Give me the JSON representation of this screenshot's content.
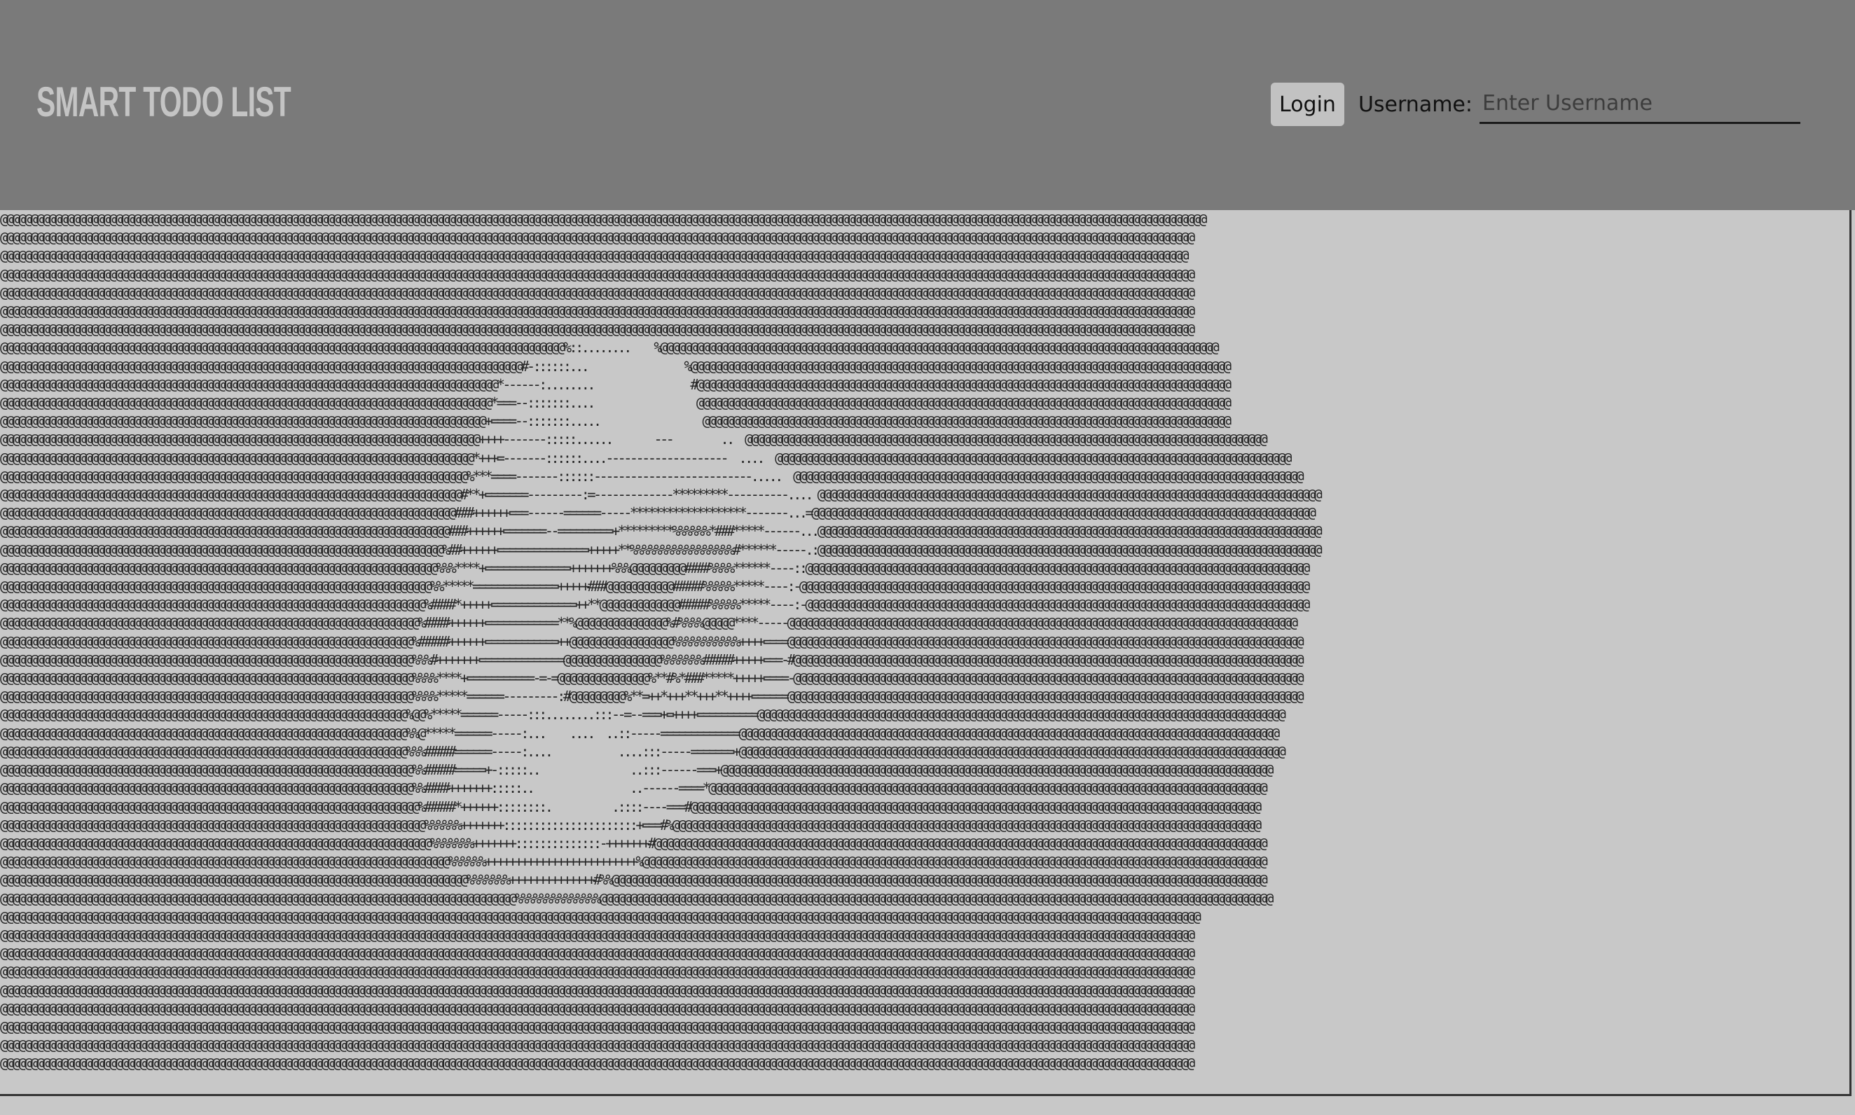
{
  "header": {
    "title": "SMART TODO LIST",
    "login_label": "Login",
    "username_label": "Username:",
    "username_placeholder": "Enter Username",
    "username_value": ""
  },
  "hero": {
    "ascii_rows": [
      "@@@@@@@@@@@@@@@@@@@@@@@@@@@@@@@@@@@@@@@@@@@@@@@@@@@@@@@@@@@@@@@@@@@@@@@@@@@@@@@@@@@@@@@@@@@@@@@@@@@@@@@@@@@@@@@@@@@@@@@@@@@@@@@@@@@@@@@@@@@@@@@@@@@@@@@@@@@@@@@@@@@@@@@@@@@@@@@@@@@@@@@@@@@@@@@@@@@@@@@",
      "@@@@@@@@@@@@@@@@@@@@@@@@@@@@@@@@@@@@@@@@@@@@@@@@@@@@@@@@@@@@@@@@@@@@@@@@@@@@@@@@@@@@@@@@@@@@@@@@@@@@@@@@@@@@@@@@@@@@@@@@@@@@@@@@@@@@@@@@@@@@@@@@@@@@@@@@@@@@@@@@@@@@@@@@@@@@@@@@@@@@@@@@@@@@@@@@@@@@@",
      "@@@@@@@@@@@@@@@@@@@@@@@@@@@@@@@@@@@@@@@@@@@@@@@@@@@@@@@@@@@@@@@@@@@@@@@@@@@@@@@@@@@@@@@@@@@@@@@@@@@@@@@@@@@@@@@@@@@@@@@@@@@@@@@@@@@@@@@@@@@@@@@@@@@@@@@@@@@@@@@@@@@@@@@@@@@@@@@@@@@@@@@@@@@@@@@@@@@@",
      "@@@@@@@@@@@@@@@@@@@@@@@@@@@@@@@@@@@@@@@@@@@@@@@@@@@@@@@@@@@@@@@@@@@@@@@@@@@@@@@@@@@@@@@@@@@@@@@@@@@@@@@@@@@@@@@@@@@@@@@@@@@@@@@@@@@@@@@@@@@@@@@@@@@@@@@@@@@@@@@@@@@@@@@@@@@@@@@@@@@@@@@@@@@@@@@@@@@@@",
      "@@@@@@@@@@@@@@@@@@@@@@@@@@@@@@@@@@@@@@@@@@@@@@@@@@@@@@@@@@@@@@@@@@@@@@@@@@@@@@@@@@@@@@@@@@@@@@@@@@@@@@@@@@@@@@@@@@@@@@@@@@@@@@@@@@@@@@@@@@@@@@@@@@@@@@@@@@@@@@@@@@@@@@@@@@@@@@@@@@@@@@@@@@@@@@@@@@@@@",
      "@@@@@@@@@@@@@@@@@@@@@@@@@@@@@@@@@@@@@@@@@@@@@@@@@@@@@@@@@@@@@@@@@@@@@@@@@@@@@@@@@@@@@@@@@@@@@@@@@@@@@@@@@@@@@@@@@@@@@@@@@@@@@@@@@@@@@@@@@@@@@@@@@@@@@@@@@@@@@@@@@@@@@@@@@@@@@@@@@@@@@@@@@@@@@@@@@@@@@",
      "@@@@@@@@@@@@@@@@@@@@@@@@@@@@@@@@@@@@@@@@@@@@@@@@@@@@@@@@@@@@@@@@@@@@@@@@@@@@@@@@@@@@@@@@@@@@@@@@@@@@@@@@@@@@@@@@@@@@@@@@@@@@@@@@@@@@@@@@@@@@@@@@@@@@@@@@@@@@@@@@@@@@@@@@@@@@@@@@@@@@@@@@@@@@@@@@@@@@@",
      "@@@@@@@@@@@@@@@@@@@@@@@@@@@@@@@@@@@@@@@@@@@@@@@@@@@@@@@@@@@@@@@@@@@@@@@@@@@@@@@@@@@@@@@@@@@@@%::........    %@@@@@@@@@@@@@@@@@@@@@@@@@@@@@@@@@@@@@@@@@@@@@@@@@@@@@@@@@@@@@@@@@@@@@@@@@@@@@@@@@@@@@@@@@@@@",
      "@@@@@@@@@@@@@@@@@@@@@@@@@@@@@@@@@@@@@@@@@@@@@@@@@@@@@@@@@@@@@@@@@@@@@@@@@@@@@@@@@@@@@@#-::::::...                %@@@@@@@@@@@@@@@@@@@@@@@@@@@@@@@@@@@@@@@@@@@@@@@@@@@@@@@@@@@@@@@@@@@@@@@@@@@@@@@@@@@@@@@@@",
      "@@@@@@@@@@@@@@@@@@@@@@@@@@@@@@@@@@@@@@@@@@@@@@@@@@@@@@@@@@@@@@@@@@@@@@@@@@@@@@@@@@*------:........                #@@@@@@@@@@@@@@@@@@@@@@@@@@@@@@@@@@@@@@@@@@@@@@@@@@@@@@@@@@@@@@@@@@@@@@@@@@@@@@@@@@@@@@@@",
      "@@@@@@@@@@@@@@@@@@@@@@@@@@@@@@@@@@@@@@@@@@@@@@@@@@@@@@@@@@@@@@@@@@@@@@@@@@@@@@@@@*===--:::::::....                 @@@@@@@@@@@@@@@@@@@@@@@@@@@@@@@@@@@@@@@@@@@@@@@@@@@@@@@@@@@@@@@@@@@@@@@@@@@@@@@@@@@@@@@@",
      "@@@@@@@@@@@@@@@@@@@@@@@@@@@@@@@@@@@@@@@@@@@@@@@@@@@@@@@@@@@@@@@@@@@@@@@@@@@@@@@@+====--:::::::.....                 @@@@@@@@@@@@@@@@@@@@@@@@@@@@@@@@@@@@@@@@@@@@@@@@@@@@@@@@@@@@@@@@@@@@@@@@@@@@@@@@@@@@@@@",
      "@@@@@@@@@@@@@@@@@@@@@@@@@@@@@@@@@@@@@@@@@@@@@@@@@@@@@@@@@@@@@@@@@@@@@@@@@@@@@@@++++-------:::::......       ---        ..  @@@@@@@@@@@@@@@@@@@@@@@@@@@@@@@@@@@@@@@@@@@@@@@@@@@@@@@@@@@@@@@@@@@@@@@@@@@@@@@@@@@@@@",
      "@@@@@@@@@@@@@@@@@@@@@@@@@@@@@@@@@@@@@@@@@@@@@@@@@@@@@@@@@@@@@@@@@@@@@@@@@@@@@@*+++=-------::::::....--------------------  ....  @@@@@@@@@@@@@@@@@@@@@@@@@@@@@@@@@@@@@@@@@@@@@@@@@@@@@@@@@@@@@@@@@@@@@@@@@@@@@@@@@@@@@",
      "@@@@@@@@@@@@@@@@@@@@@@@@@@@@@@@@@@@@@@@@@@@@@@@@@@@@@@@@@@@@@@@@@@@@@@@@@@@@@%***====-------::::::--------------------------.....  @@@@@@@@@@@@@@@@@@@@@@@@@@@@@@@@@@@@@@@@@@@@@@@@@@@@@@@@@@@@@@@@@@@@@@@@@@@@@@@@@@@@",
      "@@@@@@@@@@@@@@@@@@@@@@@@@@@@@@@@@@@@@@@@@@@@@@@@@@@@@@@@@@@@@@@@@@@@@@@@@@@@#**+=======---------:=-------------*********----------.... @@@@@@@@@@@@@@@@@@@@@@@@@@@@@@@@@@@@@@@@@@@@@@@@@@@@@@@@@@@@@@@@@@@@@@@@@@@@@@@@@@@",
      "@@@@@@@@@@@@@@@@@@@@@@@@@@@@@@@@@@@@@@@@@@@@@@@@@@@@@@@@@@@@@@@@@@@@@@@@@@@###++++++===------======-----*******************-------...=@@@@@@@@@@@@@@@@@@@@@@@@@@@@@@@@@@@@@@@@@@@@@@@@@@@@@@@@@@@@@@@@@@@@@@@@@@@@@@@@@@@",
      "@@@@@@@@@@@@@@@@@@@@@@@@@@@@@@@@@@@@@@@@@@@@@@@@@@@@@@@@@@@@@@@@@@@@@@@@@@###++++++=======--=========+*********%%%%%%*###*****------...@@@@@@@@@@@@@@@@@@@@@@@@@@@@@@@@@@@@@@@@@@@@@@@@@@@@@@@@@@@@@@@@@@@@@@@@@@@@@@@@@@@",
      "@@@@@@@@@@@@@@@@@@@@@@@@@@@@@@@@@@@@@@@@@@@@@@@@@@@@@@@@@@@@@@@@@@@@@@@@@%##++++++===============+++++**%%%%%%%%%%%%%%%%%#******-----.:@@@@@@@@@@@@@@@@@@@@@@@@@@@@@@@@@@@@@@@@@@@@@@@@@@@@@@@@@@@@@@@@@@@@@@@@@@@@@@@@@@@",
      "@@@@@@@@@@@@@@@@@@@@@@@@@@@@@@@@@@@@@@@@@@@@@@@@@@@@@@@@@@@@@@@@@@@@@@@@%%%****+==============+++++++%%%@@@@@@@@@####%%%%******----::@@@@@@@@@@@@@@@@@@@@@@@@@@@@@@@@@@@@@@@@@@@@@@@@@@@@@@@@@@@@@@@@@@@@@@@@@@@@@@@@@@@",
      "@@@@@@@@@@@@@@@@@@@@@@@@@@@@@@@@@@@@@@@@@@@@@@@@@@@@@@@@@@@@@@@@@@@@@@@%%*****==============+++++###@@@@@@@@@@@#####%%%%%*****----:-@@@@@@@@@@@@@@@@@@@@@@@@@@@@@@@@@@@@@@@@@@@@@@@@@@@@@@@@@@@@@@@@@@@@@@@@@@@@@@@@@@@@",
      "@@@@@@@@@@@@@@@@@@@@@@@@@@@@@@@@@@@@@@@@@@@@@@@@@@@@@@@@@@@@@@@@@@@@@@%####*+++++==============++**@@@@@@@@@@@@@#####%%%%%*****----:-@@@@@@@@@@@@@@@@@@@@@@@@@@@@@@@@@@@@@@@@@@@@@@@@@@@@@@@@@@@@@@@@@@@@@@@@@@@@@@@@@@@",
      "@@@@@@@@@@@@@@@@@@@@@@@@@@@@@@@@@@@@@@@@@@@@@@@@@@@@@@@@@@@@@@@@@@@@@%####++++++============**%@@@@@@@@@@@@@@@%#%%%%@@@@@****-----@@@@@@@@@@@@@@@@@@@@@@@@@@@@@@@@@@@@@@@@@@@@@@@@@@@@@@@@@@@@@@@@@@@@@@@@@@@@@@@@@@@@",
      "@@@@@@@@@@@@@@@@@@@@@@@@@@@@@@@@@@@@@@@@@@@@@@@@@@@@@@@@@@@@@@@@@@@@%#####++++++============++@@@@@@@@@@@@@@@@@%%%%%%%%%%%++++====@@@@@@@@@@@@@@@@@@@@@@@@@@@@@@@@@@@@@@@@@@@@@@@@@@@@@@@@@@@@@@@@@@@@@@@@@@@@@@@@@@@@@",
      "@@@@@@@@@@@@@@@@@@@@@@@@@@@@@@@@@@@@@@@@@@@@@@@@@@@@@@@@@@@@@@@@@@@@%%%#+++++++==============@@@@@@@@@@@@@@@@%%%%%%%#####+++++===-#@@@@@@@@@@@@@@@@@@@@@@@@@@@@@@@@@@@@@@@@@@@@@@@@@@@@@@@@@@@@@@@@@@@@@@@@@@@@@@@@@@@@",
      "@@@@@@@@@@@@@@@@@@@@@@@@@@@@@@@@@@@@@@@@@@@@@@@@@@@@@@@@@@@@@@@@@@@@%%%%****+===========-=-=@@@@@@@@@@@@@@@%**#%*###*****+++++====-@@@@@@@@@@@@@@@@@@@@@@@@@@@@@@@@@@@@@@@@@@@@@@@@@@@@@@@@@@@@@@@@@@@@@@@@@@@@@@@@@@@@",
      "@@@@@@@@@@@@@@@@@@@@@@@@@@@@@@@@@@@@@@@@@@@@@@@@@@@@@@@@@@@@@@@@@@@@%%%%*****======---------:#@@@@@@@@@%**=++*+++**+++**++++======@@@@@@@@@@@@@@@@@@@@@@@@@@@@@@@@@@@@@@@@@@@@@@@@@@@@@@@@@@@@@@@@@@@@@@@@@@@@@@@@@@@@@",
      "@@@@@@@@@@@@@@@@@@@@@@@@@@@@@@@@@@@@@@@@@@@@@@@@@@@@@@@@@@@@@@@@@@@%@@%*****======-----:::........:::--=--===+=++++==========@@@@@@@@@@@@@@@@@@@@@@@@@@@@@@@@@@@@@@@@@@@@@@@@@@@@@@@@@@@@@@@@@@@@@@@@@@@@@@@@@@@@@@@",
      "@@@@@@@@@@@@@@@@@@@@@@@@@@@@@@@@@@@@@@@@@@@@@@@@@@@@@@@@@@@@@@@@@@@%%@*****======-----:...    ....  ..::-----=============@@@@@@@@@@@@@@@@@@@@@@@@@@@@@@@@@@@@@@@@@@@@@@@@@@@@@@@@@@@@@@@@@@@@@@@@@@@@@@@@@@@@@@@@@",
      "@@@@@@@@@@@@@@@@@@@@@@@@@@@@@@@@@@@@@@@@@@@@@@@@@@@@@@@@@@@@@@@@@@@%%%#####======-----:....           ....:::-----=======+@@@@@@@@@@@@@@@@@@@@@@@@@@@@@@@@@@@@@@@@@@@@@@@@@@@@@@@@@@@@@@@@@@@@@@@@@@@@@@@@@@@@@@@@@@",
      "@@@@@@@@@@@@@@@@@@@@@@@@@@@@@@@@@@@@@@@@@@@@@@@@@@@@@@@@@@@@@@@@@@@@%%#####=====+-:::::..               ..:::------===+@@@@@@@@@@@@@@@@@@@@@@@@@@@@@@@@@@@@@@@@@@@@@@@@@@@@@@@@@@@@@@@@@@@@@@@@@@@@@@@@@@@@@@@@@@@",
      "@@@@@@@@@@@@@@@@@@@@@@@@@@@@@@@@@@@@@@@@@@@@@@@@@@@@@@@@@@@@@@@@@@@@%%####+++++++:::::..                ..------====*@@@@@@@@@@@@@@@@@@@@@@@@@@@@@@@@@@@@@@@@@@@@@@@@@@@@@@@@@@@@@@@@@@@@@@@@@@@@@@@@@@@@@@@@@@@@",
      "@@@@@@@@@@@@@@@@@@@@@@@@@@@@@@@@@@@@@@@@@@@@@@@@@@@@@@@@@@@@@@@@@@@@@%#####*++++++::::::::.          .::::----===#@@@@@@@@@@@@@@@@@@@@@@@@@@@@@@@@@@@@@@@@@@@@@@@@@@@@@@@@@@@@@@@@@@@@@@@@@@@@@@@@@@@@@@@@@@@@@@",
      "@@@@@@@@@@@@@@@@@@@@@@@@@@@@@@@@@@@@@@@@@@@@@@@@@@@@@@@@@@@@@@@@@@@@@@%%%%%%+++++++::::::::::::::::::::::+===#%@@@@@@@@@@@@@@@@@@@@@@@@@@@@@@@@@@@@@@@@@@@@@@@@@@@@@@@@@@@@@@@@@@@@@@@@@@@@@@@@@@@@@@@@@@@@@@@@@",
      "@@@@@@@@@@@@@@@@@@@@@@@@@@@@@@@@@@@@@@@@@@@@@@@@@@@@@@@@@@@@@@@@@@@@@@@%%%%%%%+++++++::::::::::::::-+++++++#@@@@@@@@@@@@@@@@@@@@@@@@@@@@@@@@@@@@@@@@@@@@@@@@@@@@@@@@@@@@@@@@@@@@@@@@@@@@@@@@@@@@@@@@@@@@@@@@@@@@@",
      "@@@@@@@@@@@@@@@@@@@@@@@@@@@@@@@@@@@@@@@@@@@@@@@@@@@@@@@@@@@@@@@@@@@@@@@@@@%%%%%%+++++++++++++++++++++++++%@@@@@@@@@@@@@@@@@@@@@@@@@@@@@@@@@@@@@@@@@@@@@@@@@@@@@@@@@@@@@@@@@@@@@@@@@@@@@@@@@@@@@@@@@@@@@@@@@@@@@@@",
      "@@@@@@@@@@@@@@@@@@@@@@@@@@@@@@@@@@@@@@@@@@@@@@@@@@@@@@@@@@@@@@@@@@@@@@@@@@@@@%%%%%%%++++++++++++++#%%@@@@@@@@@@@@@@@@@@@@@@@@@@@@@@@@@@@@@@@@@@@@@@@@@@@@@@@@@@@@@@@@@@@@@@@@@@@@@@@@@@@@@@@@@@@@@@@@@@@@@@@@@@@@",
      "@@@@@@@@@@@@@@@@@@@@@@@@@@@@@@@@@@@@@@@@@@@@@@@@@@@@@@@@@@@@@@@@@@@@@@@@@@@@@@@@@@@@@%%%%%%%%%%%%%%@@@@@@@@@@@@@@@@@@@@@@@@@@@@@@@@@@@@@@@@@@@@@@@@@@@@@@@@@@@@@@@@@@@@@@@@@@@@@@@@@@@@@@@@@@@@@@@@@@@@@@@@@@@@@@@",
      "@@@@@@@@@@@@@@@@@@@@@@@@@@@@@@@@@@@@@@@@@@@@@@@@@@@@@@@@@@@@@@@@@@@@@@@@@@@@@@@@@@@@@@@@@@@@@@@@@@@@@@@@@@@@@@@@@@@@@@@@@@@@@@@@@@@@@@@@@@@@@@@@@@@@@@@@@@@@@@@@@@@@@@@@@@@@@@@@@@@@@@@@@@@@@@@@@@@@@@",
      "@@@@@@@@@@@@@@@@@@@@@@@@@@@@@@@@@@@@@@@@@@@@@@@@@@@@@@@@@@@@@@@@@@@@@@@@@@@@@@@@@@@@@@@@@@@@@@@@@@@@@@@@@@@@@@@@@@@@@@@@@@@@@@@@@@@@@@@@@@@@@@@@@@@@@@@@@@@@@@@@@@@@@@@@@@@@@@@@@@@@@@@@@@@@@@@@@@@@@",
      "@@@@@@@@@@@@@@@@@@@@@@@@@@@@@@@@@@@@@@@@@@@@@@@@@@@@@@@@@@@@@@@@@@@@@@@@@@@@@@@@@@@@@@@@@@@@@@@@@@@@@@@@@@@@@@@@@@@@@@@@@@@@@@@@@@@@@@@@@@@@@@@@@@@@@@@@@@@@@@@@@@@@@@@@@@@@@@@@@@@@@@@@@@@@@@@@@@@@@",
      "@@@@@@@@@@@@@@@@@@@@@@@@@@@@@@@@@@@@@@@@@@@@@@@@@@@@@@@@@@@@@@@@@@@@@@@@@@@@@@@@@@@@@@@@@@@@@@@@@@@@@@@@@@@@@@@@@@@@@@@@@@@@@@@@@@@@@@@@@@@@@@@@@@@@@@@@@@@@@@@@@@@@@@@@@@@@@@@@@@@@@@@@@@@@@@@@@@@@@",
      "@@@@@@@@@@@@@@@@@@@@@@@@@@@@@@@@@@@@@@@@@@@@@@@@@@@@@@@@@@@@@@@@@@@@@@@@@@@@@@@@@@@@@@@@@@@@@@@@@@@@@@@@@@@@@@@@@@@@@@@@@@@@@@@@@@@@@@@@@@@@@@@@@@@@@@@@@@@@@@@@@@@@@@@@@@@@@@@@@@@@@@@@@@@@@@@@@@@@@",
      "@@@@@@@@@@@@@@@@@@@@@@@@@@@@@@@@@@@@@@@@@@@@@@@@@@@@@@@@@@@@@@@@@@@@@@@@@@@@@@@@@@@@@@@@@@@@@@@@@@@@@@@@@@@@@@@@@@@@@@@@@@@@@@@@@@@@@@@@@@@@@@@@@@@@@@@@@@@@@@@@@@@@@@@@@@@@@@@@@@@@@@@@@@@@@@@@@@@@@",
      "@@@@@@@@@@@@@@@@@@@@@@@@@@@@@@@@@@@@@@@@@@@@@@@@@@@@@@@@@@@@@@@@@@@@@@@@@@@@@@@@@@@@@@@@@@@@@@@@@@@@@@@@@@@@@@@@@@@@@@@@@@@@@@@@@@@@@@@@@@@@@@@@@@@@@@@@@@@@@@@@@@@@@@@@@@@@@@@@@@@@@@@@@@@@@@@@@@@@@",
      "@@@@@@@@@@@@@@@@@@@@@@@@@@@@@@@@@@@@@@@@@@@@@@@@@@@@@@@@@@@@@@@@@@@@@@@@@@@@@@@@@@@@@@@@@@@@@@@@@@@@@@@@@@@@@@@@@@@@@@@@@@@@@@@@@@@@@@@@@@@@@@@@@@@@@@@@@@@@@@@@@@@@@@@@@@@@@@@@@@@@@@@@@@@@@@@@@@@@@",
      "@@@@@@@@@@@@@@@@@@@@@@@@@@@@@@@@@@@@@@@@@@@@@@@@@@@@@@@@@@@@@@@@@@@@@@@@@@@@@@@@@@@@@@@@@@@@@@@@@@@@@@@@@@@@@@@@@@@@@@@@@@@@@@@@@@@@@@@@@@@@@@@@@@@@@@@@@@@@@@@@@@@@@@@@@@@@@@@@@@@@@@@@@@@@@@@@@@@@@"
    ]
  }
}
